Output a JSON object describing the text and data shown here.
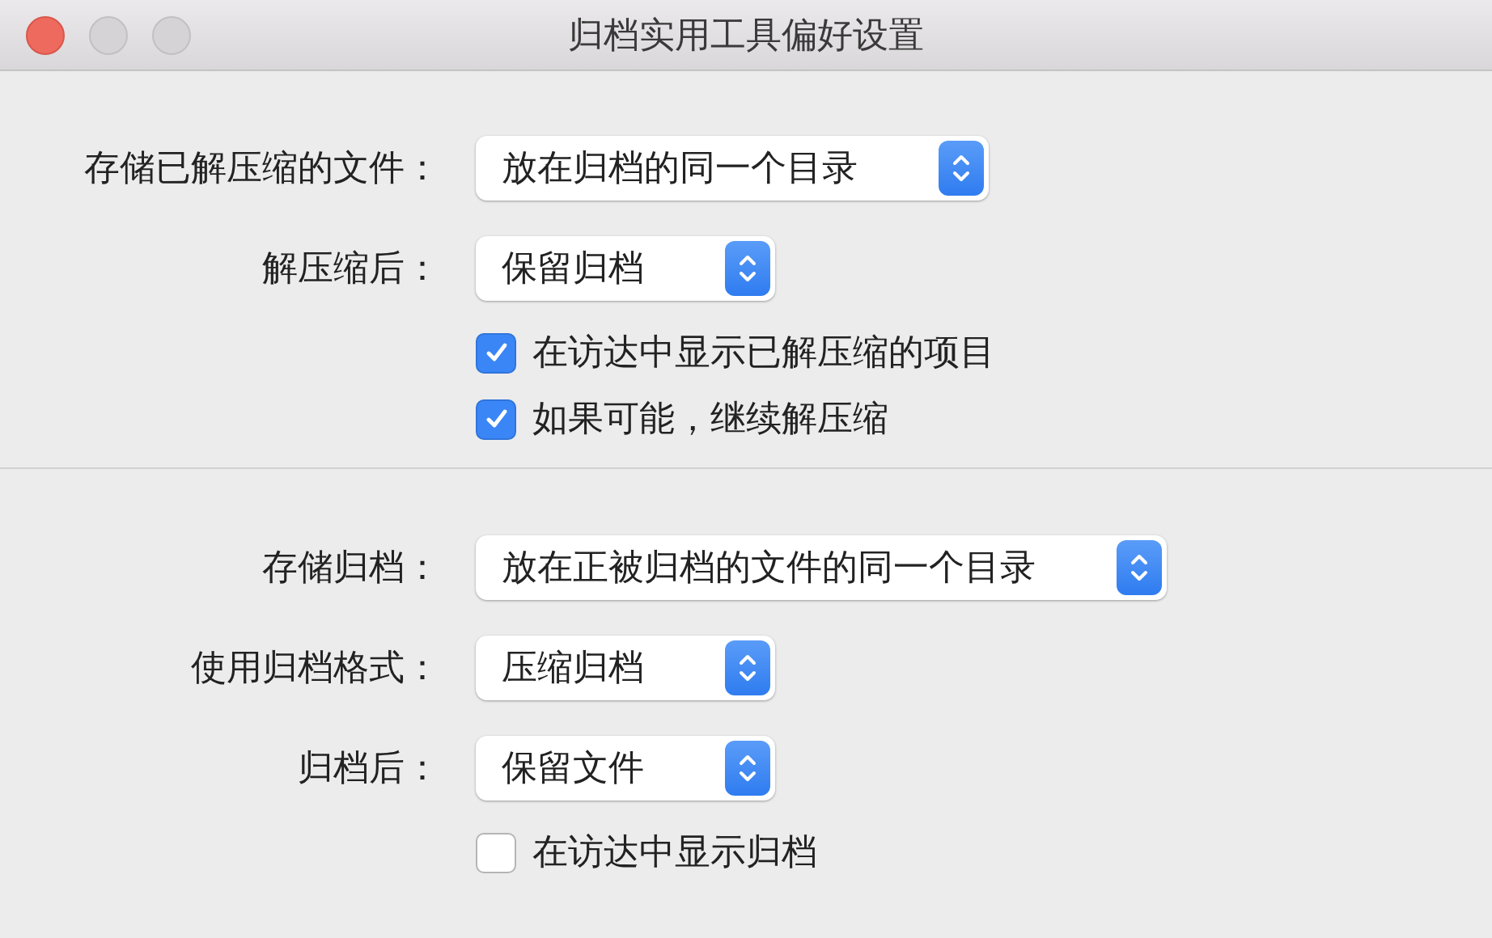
{
  "window": {
    "title": "归档实用工具偏好设置"
  },
  "sections": [
    {
      "rows": [
        {
          "kind": "popup",
          "label": "存储已解压缩的文件：",
          "value": "放在归档的同一个目录"
        },
        {
          "kind": "popup",
          "label": "解压缩后：",
          "value": "保留归档"
        },
        {
          "kind": "checkbox",
          "label": "在访达中显示已解压缩的项目",
          "checked": true
        },
        {
          "kind": "checkbox",
          "label": "如果可能，继续解压缩",
          "checked": true
        }
      ]
    },
    {
      "rows": [
        {
          "kind": "popup",
          "label": "存储归档：",
          "value": "放在正被归档的文件的同一个目录"
        },
        {
          "kind": "popup",
          "label": "使用归档格式：",
          "value": "压缩归档"
        },
        {
          "kind": "popup",
          "label": "归档后：",
          "value": "保留文件"
        },
        {
          "kind": "checkbox",
          "label": "在访达中显示归档",
          "checked": false
        }
      ]
    }
  ]
}
